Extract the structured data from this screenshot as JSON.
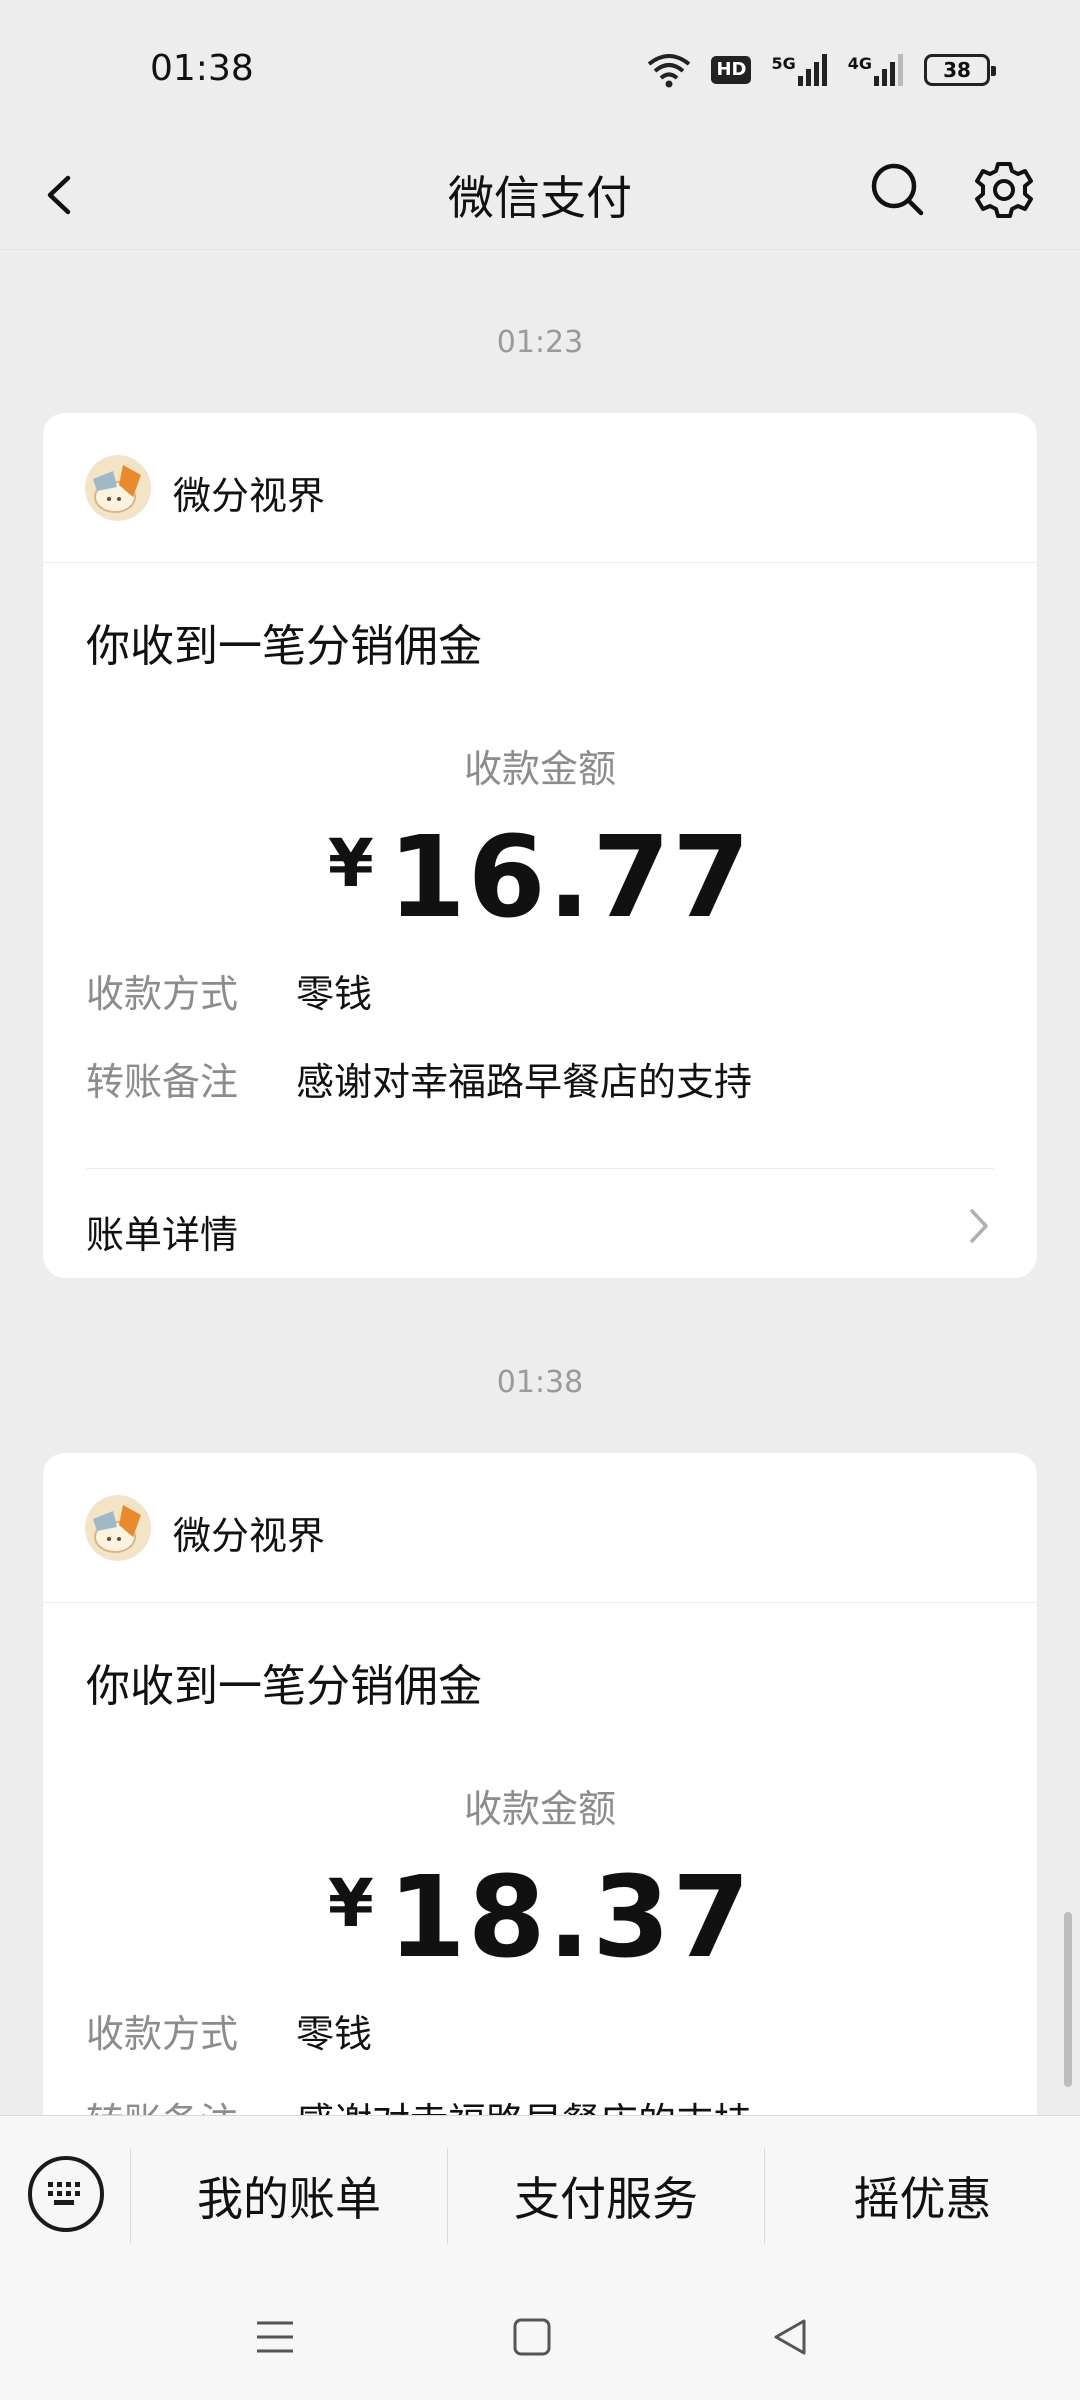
{
  "status_bar": {
    "time": "01:38",
    "hd": "HD",
    "net1": "5G",
    "net2": "4G",
    "battery": "38"
  },
  "header": {
    "title": "微信支付"
  },
  "messages": [
    {
      "time": "01:23",
      "merchant": "微分视界",
      "title": "你收到一笔分销佣金",
      "amount_label": "收款金额",
      "currency": "¥",
      "amount": "16.77",
      "method_key": "收款方式",
      "method_value": "零钱",
      "note_key": "转账备注",
      "note_value": "感谢对幸福路早餐店的支持",
      "detail_label": "账单详情"
    },
    {
      "time": "01:38",
      "merchant": "微分视界",
      "title": "你收到一笔分销佣金",
      "amount_label": "收款金额",
      "currency": "¥",
      "amount": "18.37",
      "method_key": "收款方式",
      "method_value": "零钱",
      "note_key": "转账备注",
      "note_value": "感谢对幸福路早餐店的支持"
    }
  ],
  "bottom_menu": {
    "item1": "我的账单",
    "item2": "支付服务",
    "item3": "摇优惠"
  },
  "icons": [
    "back-icon",
    "search-icon",
    "gear-icon",
    "keyboard-icon",
    "chevron-right-icon",
    "wifi-icon",
    "signal-icon",
    "menu-icon",
    "home-icon",
    "back-triangle-icon"
  ]
}
